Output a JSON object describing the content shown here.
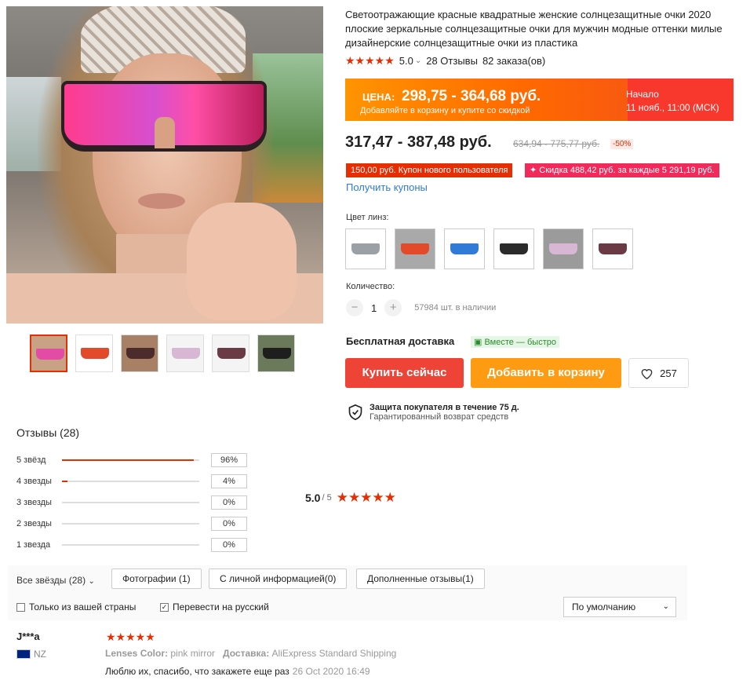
{
  "product": {
    "title": "Светоотражающие красные квадратные женские солнцезащитные очки 2020 плоские зеркальные солнцезащитные очки для мужчин модные оттенки милые дизайнерские солнцезащитные очки из пластика",
    "rating": "5.0",
    "reviews_link": "28 Отзывы",
    "orders": "82 заказа(ов)",
    "stars": "★★★★★"
  },
  "promo": {
    "label": "ЦЕНА:",
    "price": "298,75 - 364,68 руб.",
    "note": "Добавляйте в корзину и купите со скидкой",
    "start_label": "Начало",
    "start_date": "11 нояб., 11:00 (МСК)"
  },
  "pricing": {
    "current": "317,47 - 387,48 руб.",
    "old": "634,94 - 775,77 руб.",
    "discount": "-50%",
    "coupon_new": "150,00 руб. Купон нового пользователя",
    "coupon_discount": "✦ Скидка 488,42 руб. за каждые 5 291,19 руб.",
    "get_coupons": "Получить купоны"
  },
  "options": {
    "color_label": "Цвет линз:",
    "swatch_colors": [
      "#9aa0a6",
      "#e24a2a",
      "#2f7bd6",
      "#2b2b2b",
      "#d7b7d3",
      "#6b3b45"
    ],
    "quantity_label": "Количество:",
    "minus": "−",
    "quantity": "1",
    "plus": "+",
    "stock": "57984 шт. в наличии"
  },
  "shipping": {
    "free": "Бесплатная доставка",
    "fast": "Вместе — быстро"
  },
  "actions": {
    "buy": "Купить сейчас",
    "cart": "Добавить в корзину",
    "wishlist_count": "257"
  },
  "protection": {
    "title": "Защита покупателя в течение 75 д.",
    "subtitle": "Гарантированный возврат средств"
  },
  "reviews": {
    "title": "Отзывы (28)",
    "score": "5.0",
    "score_of": "/ 5",
    "stars": "★★★★★",
    "breakdown": [
      {
        "label": "5 звёзд",
        "pct": "96%",
        "fraction": 0.96
      },
      {
        "label": "4 звезды",
        "pct": "4%",
        "fraction": 0.04
      },
      {
        "label": "3 звезды",
        "pct": "0%",
        "fraction": 0
      },
      {
        "label": "2 звезды",
        "pct": "0%",
        "fraction": 0
      },
      {
        "label": "1 звезда",
        "pct": "0%",
        "fraction": 0
      }
    ],
    "filter_all": "Все звёзды (28)",
    "filter_photos": "Фотографии (1)",
    "filter_personal": "С личной информацией(0)",
    "filter_additional": "Дополненные отзывы(1)",
    "check_country": "Только из вашей страны",
    "check_translate": "Перевести на русский",
    "sort": "По умолчанию",
    "items": [
      {
        "user": "J***a",
        "country": "NZ",
        "stars": "★★★★★",
        "attr1_label": "Lenses Color:",
        "attr1_value": "pink mirror",
        "attr2_label": "Доставка:",
        "attr2_value": "AliExpress Standard Shipping",
        "text": "Люблю их, спасибо, что закажете еще раз",
        "date": "26 Oct 2020 16:49"
      }
    ]
  }
}
